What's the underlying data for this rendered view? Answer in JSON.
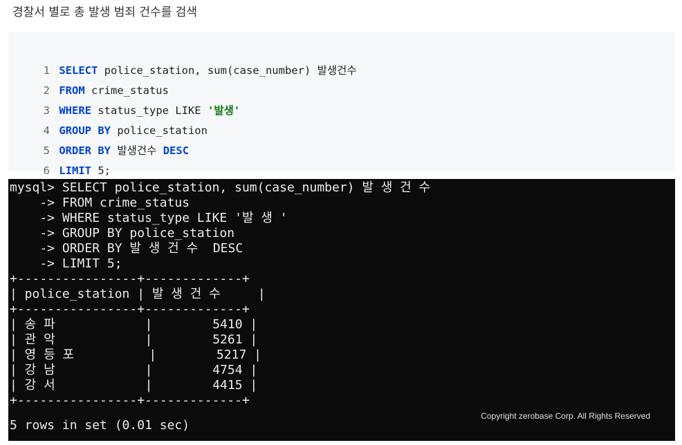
{
  "title": "경찰서 별로 총 발생 범죄 건수를 검색",
  "code": {
    "lines": [
      {
        "num": "1",
        "kw1": "SELECT",
        "text1": " police_station, sum(case_number) 발생건수"
      },
      {
        "num": "2",
        "kw1": "FROM",
        "text1": " crime_status"
      },
      {
        "num": "3",
        "kw1": "WHERE",
        "text1": " status_type LIKE ",
        "str": "'발생'"
      },
      {
        "num": "4",
        "kw1": "GROUP BY",
        "text1": " police_station"
      },
      {
        "num": "5",
        "kw1": "ORDER BY",
        "text1": " 발생건수 ",
        "kw2": "DESC"
      },
      {
        "num": "6",
        "kw1": "LIMIT",
        "text1": " 5;"
      }
    ]
  },
  "terminal": {
    "lines": [
      "mysql> SELECT police_station, sum(case_number) 발 생 건 수",
      "    -> FROM crime_status",
      "    -> WHERE status_type LIKE '발 생 '",
      "    -> GROUP BY police_station",
      "    -> ORDER BY 발 생 건 수  DESC",
      "    -> LIMIT 5;",
      "+----------------+-------------+",
      "| police_station | 발 생 건 수     |",
      "+----------------+-------------+",
      "| 송 파            |        5410 |",
      "| 관 악            |        5261 |",
      "| 영 등 포          |        5217 |",
      "| 강 남            |        4754 |",
      "| 강 서            |        4415 |",
      "+----------------+-------------+",
      "5 rows in set (0.01 sec)"
    ]
  },
  "copyright": "Copyright zerobase Corp. All Rights Reserved"
}
